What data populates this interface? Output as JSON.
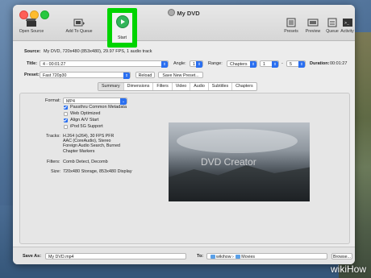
{
  "window": {
    "title": "My DVD"
  },
  "toolbar": {
    "open_source": "Open Source",
    "add_to_queue": "Add To Queue",
    "start": "Start",
    "presets": "Presets",
    "preview": "Preview",
    "queue": "Queue",
    "activity": "Activity"
  },
  "source": {
    "label": "Source:",
    "value": "My DVD, 720x480 (853x480), 29.97 FPS, 1 audio track"
  },
  "title_row": {
    "title_label": "Title:",
    "title_value": "4 - 00:01:27",
    "angle_label": "Angle:",
    "angle_value": "1",
    "range_label": "Range:",
    "range_value": "Chapters",
    "range_from": "1",
    "range_dash": "-",
    "range_to": "5",
    "duration_label": "Duration:",
    "duration_value": "00:01:27"
  },
  "preset_row": {
    "preset_label": "Preset:",
    "preset_value": "Fast 720p30",
    "reload": "Reload",
    "save_new": "Save New Preset..."
  },
  "tabs": [
    "Summary",
    "Dimensions",
    "Filters",
    "Video",
    "Audio",
    "Subtitles",
    "Chapters"
  ],
  "summary": {
    "format_label": "Format:",
    "format_value": "MP4",
    "passthru": "Passthru Common Metadata",
    "web_optimized": "Web Optimized",
    "align_av": "Align A/V Start",
    "ipod": "iPod 5G Support",
    "tracks_label": "Tracks:",
    "tracks_lines": [
      "H.264 (x264), 30 FPS PFR",
      "AAC (CoreAudio), Stereo",
      "Foreign Audio Search, Burned",
      "Chapter Markers"
    ],
    "filters_label": "Filters:",
    "filters_value": "Comb Detect, Decomb",
    "size_label": "Size:",
    "size_value": "720x480 Storage, 853x480 Display",
    "preview_watermark": "DVD Creator"
  },
  "bottom": {
    "save_as_label": "Save As:",
    "save_as_value": "My DVD.mp4",
    "to_label": "To:",
    "to_path_1": "wikihow",
    "to_sep": "›",
    "to_path_2": "Movies",
    "browse": "Browse..."
  },
  "watermark": {
    "brand": "wikiHow"
  },
  "colors": {
    "start_highlight": "#00d400",
    "accent_blue": "#2a6ff0",
    "start_green": "#33b55a"
  }
}
